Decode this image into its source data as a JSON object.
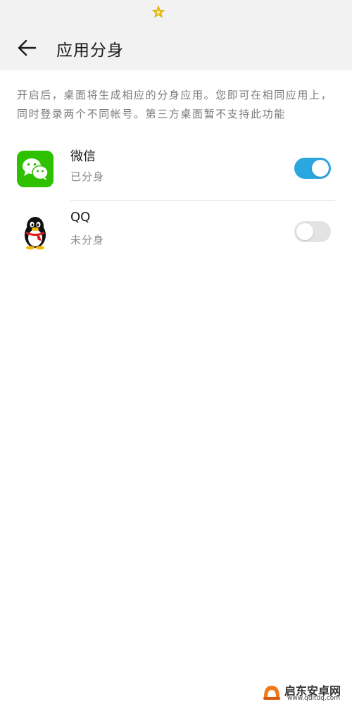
{
  "header": {
    "title": "应用分身"
  },
  "description": "开启后，桌面将生成相应的分身应用。您即可在相同应用上，同时登录两个不同帐号。第三方桌面暂不支持此功能",
  "apps": [
    {
      "name": "微信",
      "status": "已分身",
      "enabled": true,
      "icon": "wechat-icon"
    },
    {
      "name": "QQ",
      "status": "未分身",
      "enabled": false,
      "icon": "qq-penguin-icon"
    }
  ],
  "colors": {
    "toggle_on": "#2aa6e0",
    "toggle_off": "#e3e3e3",
    "wechat_green": "#2dc100",
    "header_bg": "#f2f2f2"
  },
  "watermark": {
    "text": "启东安卓网",
    "url": "www.qdltdq.com"
  }
}
